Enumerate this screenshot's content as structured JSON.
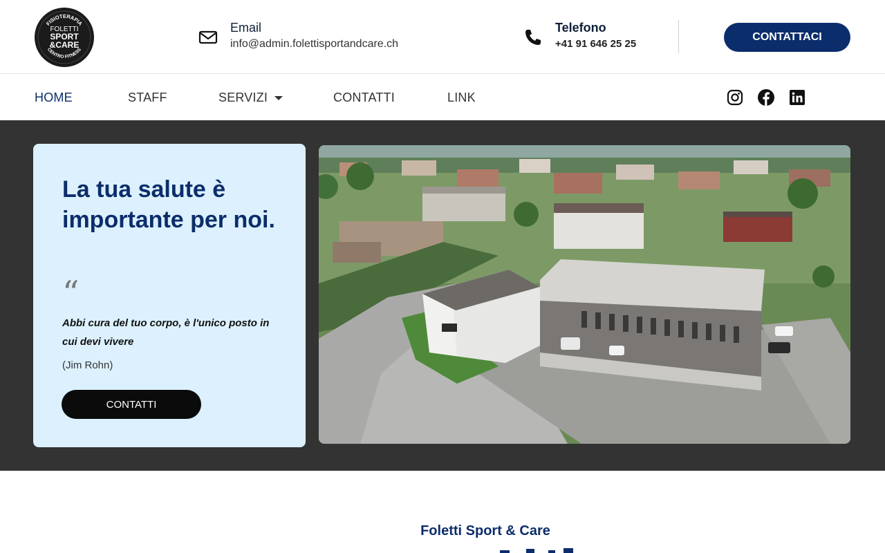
{
  "brand": {
    "logo_top": "FISIOTERAPIA",
    "logo_line1": "FOLETTI",
    "logo_line2": "SPORT",
    "logo_line3": "&CARE",
    "logo_bottom": "CENTRO FITNESS"
  },
  "header": {
    "email_title": "Email",
    "email_value": "info@admin.folettisportandcare.ch",
    "phone_title": "Telefono",
    "phone_value": "+41 91 646 25 25",
    "cta_label": "CONTATTACI"
  },
  "nav": {
    "items": [
      "HOME",
      "STAFF",
      "SERVIZI",
      "CONTATTI",
      "LINK"
    ],
    "active": "HOME"
  },
  "social": [
    "instagram-icon",
    "facebook-icon",
    "linkedin-icon"
  ],
  "hero": {
    "heading": "La tua salute è importante per noi.",
    "quote_mark": "“",
    "quote": "Abbi cura del tuo corpo, è l'unico posto in cui devi vivere",
    "author": "(Jim Rohn)",
    "button_label": "CONTATTI"
  },
  "section": {
    "title": "Foletti Sport & Care"
  },
  "colors": {
    "brand_blue": "#0c2d6b",
    "hero_bg": "#333333",
    "card_bg": "#dcf1fd",
    "button_dark": "#0b0b0b"
  }
}
